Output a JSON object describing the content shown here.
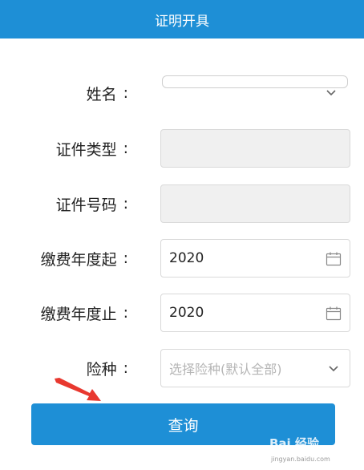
{
  "header": {
    "title": "证明开具"
  },
  "form": {
    "name": {
      "label": "姓名",
      "colon": ":",
      "value": ""
    },
    "id_type": {
      "label": "证件类型",
      "colon": ":",
      "value": ""
    },
    "id_number": {
      "label": "证件号码",
      "colon": ":",
      "value": ""
    },
    "year_start": {
      "label": "缴费年度起",
      "colon": ":",
      "value": "2020"
    },
    "year_end": {
      "label": "缴费年度止",
      "colon": ":",
      "value": "2020"
    },
    "insurance_type": {
      "label": "险种",
      "colon": ":",
      "placeholder": "选择险种(默认全部)"
    }
  },
  "actions": {
    "query_label": "查询"
  },
  "watermark": {
    "brand": "Bai 经验",
    "url": "jingyan.baidu.com"
  },
  "colors": {
    "primary": "#1e8fd6",
    "disabled_bg": "#f0f0f0",
    "arrow": "#e8382f"
  },
  "icons": {
    "dropdown": "chevron-down-icon",
    "calendar": "calendar-icon",
    "annotation": "red-arrow-icon"
  }
}
